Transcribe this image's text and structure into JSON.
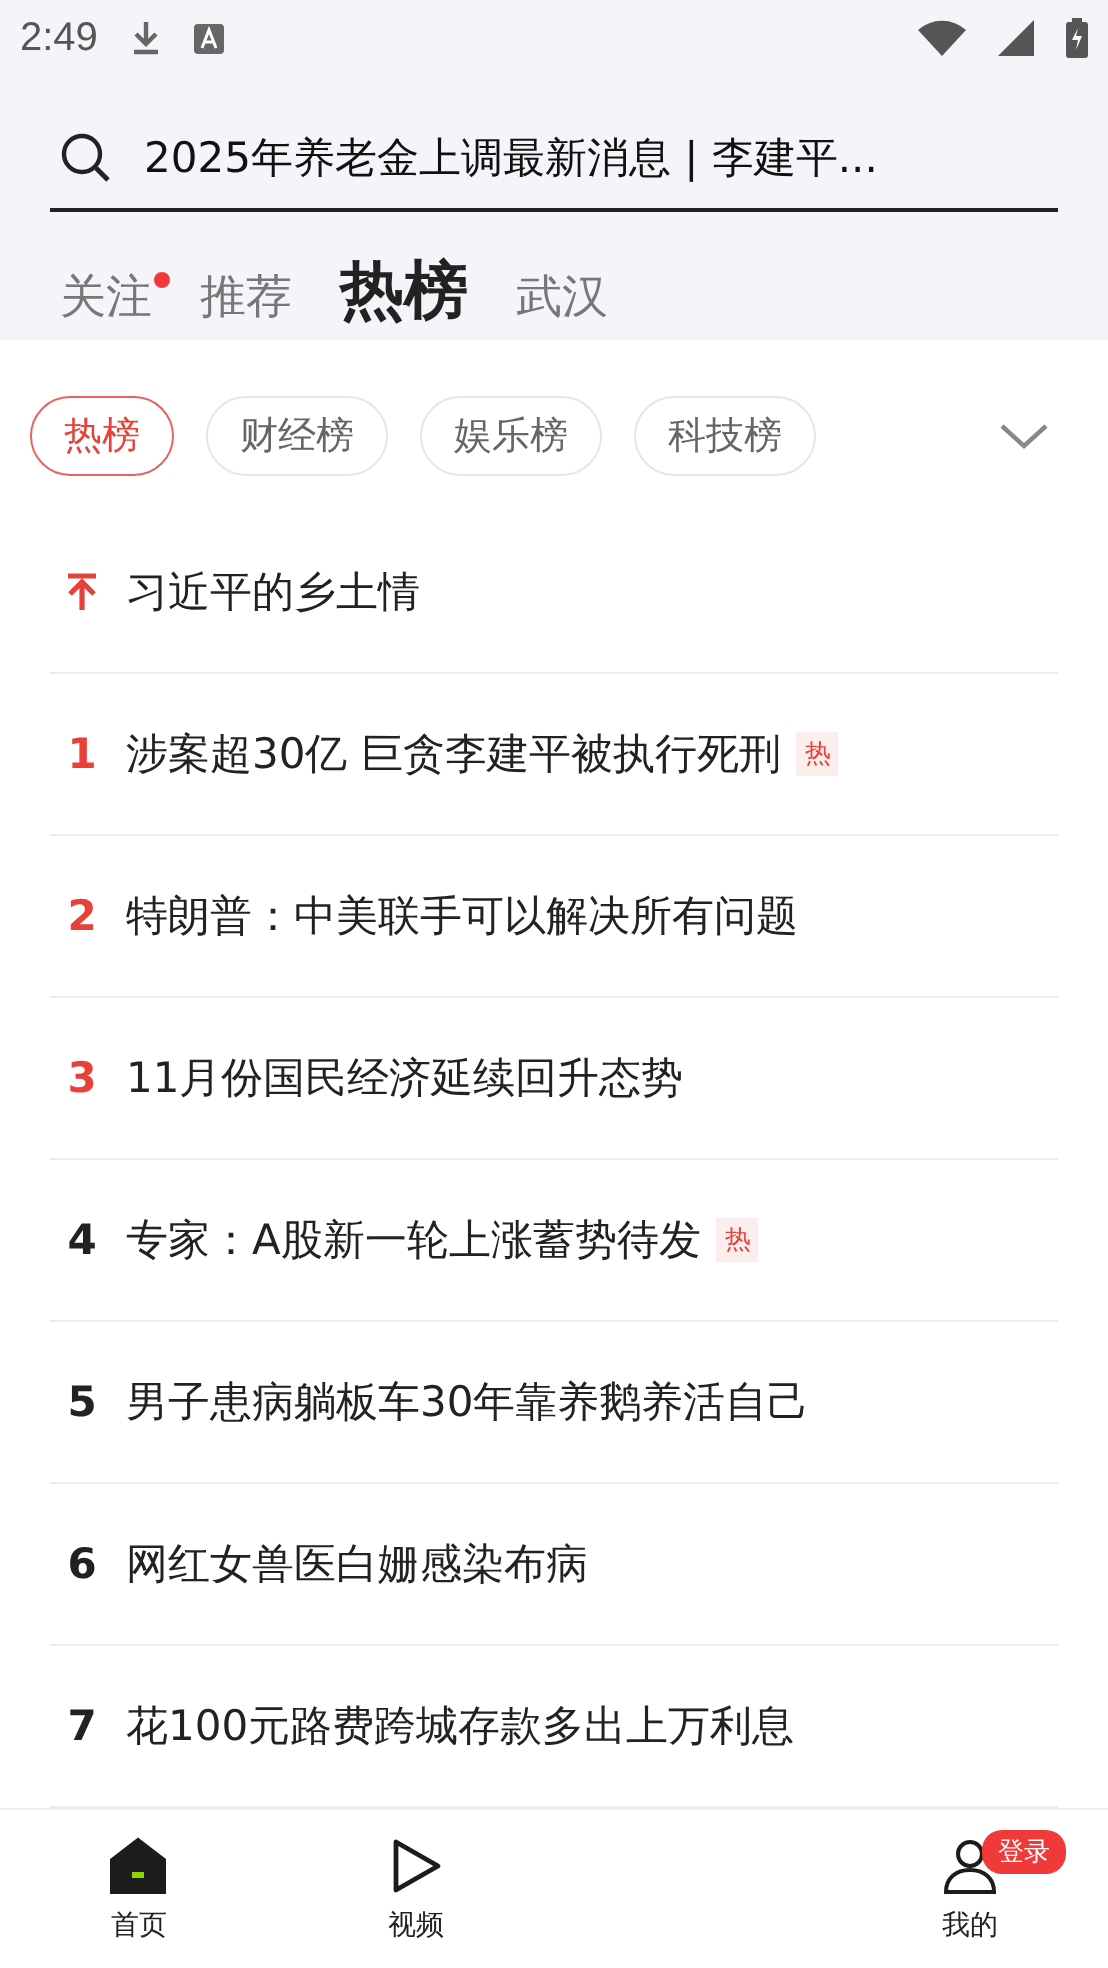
{
  "status_bar": {
    "time": "2:49"
  },
  "search": {
    "value": "2025年养老金上调最新消息 | 李建平..."
  },
  "tabs": [
    {
      "label": "关注",
      "selected": false,
      "dot": true
    },
    {
      "label": "推荐",
      "selected": false,
      "dot": false
    },
    {
      "label": "热榜",
      "selected": true,
      "dot": false
    },
    {
      "label": "武汉",
      "selected": false,
      "dot": false
    }
  ],
  "chips": [
    {
      "label": "热榜",
      "selected": true
    },
    {
      "label": "财经榜",
      "selected": false
    },
    {
      "label": "娱乐榜",
      "selected": false
    },
    {
      "label": "科技榜",
      "selected": false
    }
  ],
  "hot_list": [
    {
      "kind": "pinned",
      "title": "习近平的乡土情"
    },
    {
      "kind": "ranked",
      "rank": "1",
      "color": "#e8413a",
      "title": "涉案超30亿 巨贪李建平被执行死刑",
      "tag": "热"
    },
    {
      "kind": "ranked",
      "rank": "2",
      "color": "#e8413a",
      "title": "特朗普：中美联手可以解决所有问题"
    },
    {
      "kind": "ranked",
      "rank": "3",
      "color": "#e8413a",
      "title": "11月份国民经济延续回升态势"
    },
    {
      "kind": "ranked",
      "rank": "4",
      "color": "#222222",
      "title": "专家：A股新一轮上涨蓄势待发",
      "tag": "热"
    },
    {
      "kind": "ranked",
      "rank": "5",
      "color": "#222222",
      "title": "男子患病躺板车30年靠养鹅养活自己"
    },
    {
      "kind": "ranked",
      "rank": "6",
      "color": "#222222",
      "title": "网红女兽医白姗感染布病"
    },
    {
      "kind": "ranked",
      "rank": "7",
      "color": "#222222",
      "title": "花100元路费跨城存款多出上万利息"
    }
  ],
  "bottom_nav": [
    {
      "kind": "home",
      "label": "首页",
      "selected": true
    },
    {
      "kind": "video",
      "label": "视频",
      "selected": false
    },
    {
      "kind": "profile",
      "label": "我的",
      "selected": false,
      "badge": "登录"
    }
  ]
}
